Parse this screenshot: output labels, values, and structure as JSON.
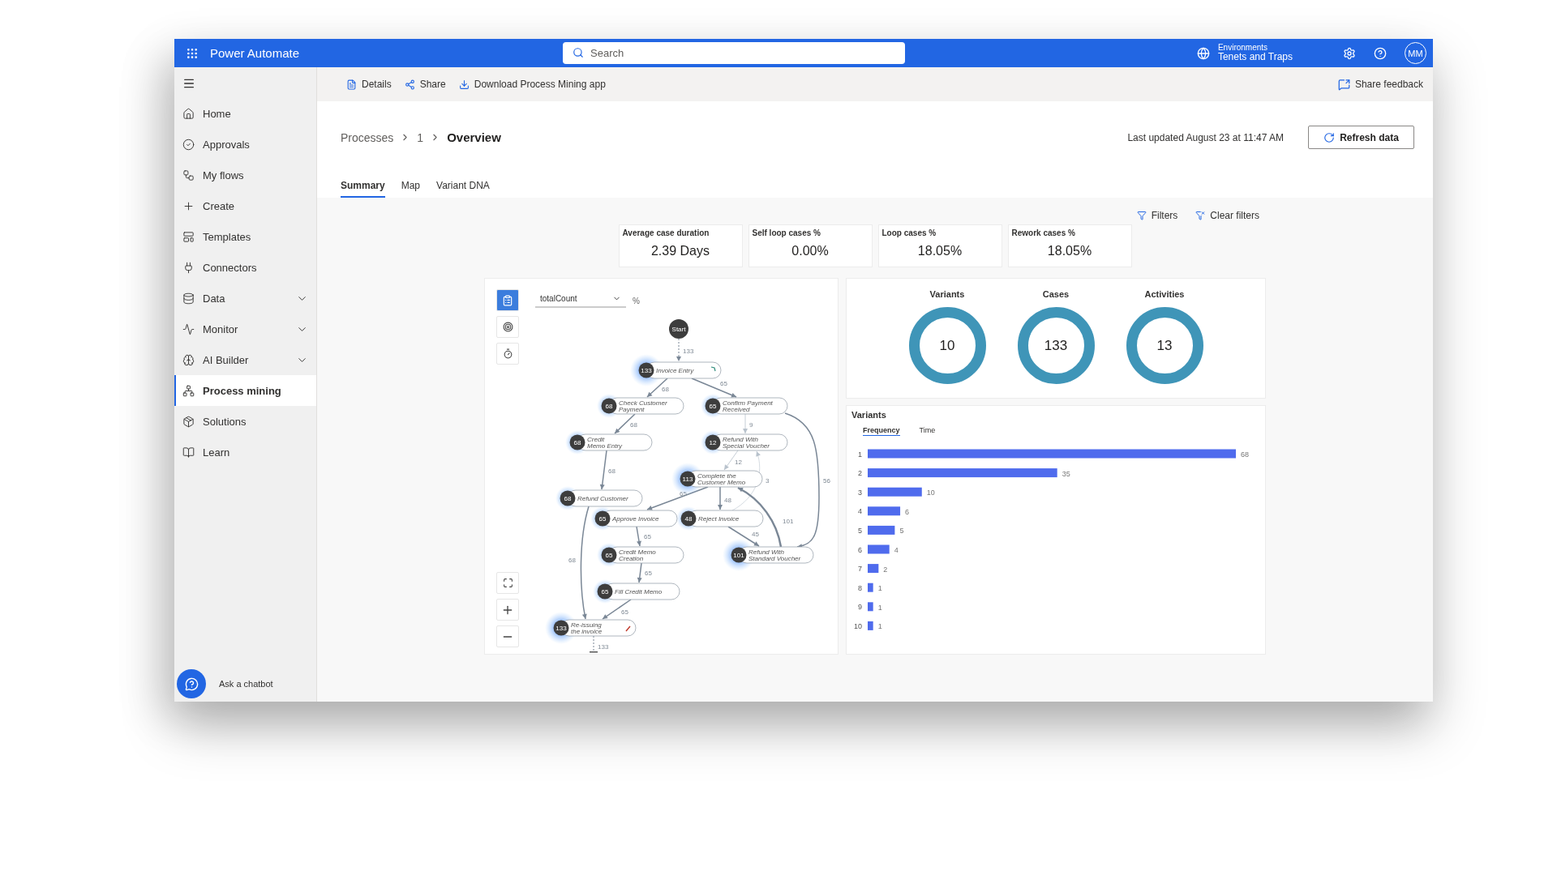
{
  "app": {
    "title": "Power Automate"
  },
  "search": {
    "placeholder": "Search"
  },
  "environment": {
    "caption": "Environments",
    "name": "Tenets and Traps"
  },
  "user": {
    "initials": "MM"
  },
  "command_bar": {
    "items": [
      "Details",
      "Share",
      "Download Process Mining app"
    ],
    "feedback": "Share feedback"
  },
  "sidebar": {
    "items": [
      {
        "label": "Home",
        "expandable": false,
        "selected": false
      },
      {
        "label": "Approvals",
        "expandable": false,
        "selected": false
      },
      {
        "label": "My flows",
        "expandable": false,
        "selected": false
      },
      {
        "label": "Create",
        "expandable": false,
        "selected": false
      },
      {
        "label": "Templates",
        "expandable": false,
        "selected": false
      },
      {
        "label": "Connectors",
        "expandable": false,
        "selected": false
      },
      {
        "label": "Data",
        "expandable": true,
        "selected": false
      },
      {
        "label": "Monitor",
        "expandable": true,
        "selected": false
      },
      {
        "label": "AI Builder",
        "expandable": true,
        "selected": false
      },
      {
        "label": "Process mining",
        "expandable": false,
        "selected": true
      },
      {
        "label": "Solutions",
        "expandable": false,
        "selected": false
      },
      {
        "label": "Learn",
        "expandable": false,
        "selected": false
      }
    ],
    "chatbot": "Ask a chatbot"
  },
  "breadcrumb": [
    "Processes",
    "1",
    "Overview"
  ],
  "last_updated": "Last updated August 23 at 11:47 AM",
  "refresh_button": "Refresh data",
  "tabs": [
    {
      "label": "Summary",
      "selected": true
    },
    {
      "label": "Map",
      "selected": false
    },
    {
      "label": "Variant DNA",
      "selected": false
    }
  ],
  "filters": [
    "Filters",
    "Clear filters"
  ],
  "kpis": [
    {
      "label": "Average case duration",
      "value": "2.39 Days"
    },
    {
      "label": "Self loop cases %",
      "value": "0.00%"
    },
    {
      "label": "Loop cases %",
      "value": "18.05%"
    },
    {
      "label": "Rework cases %",
      "value": "18.05%"
    }
  ],
  "map": {
    "metric": "totalCount",
    "unit": "%",
    "start": "Start",
    "nodes": [
      {
        "kind": "start",
        "count": "133",
        "label": "Invoice Entry"
      },
      {
        "kind": "activity",
        "count": "68",
        "label": "Check Customer Payment"
      },
      {
        "kind": "activity",
        "count": "65",
        "label": "Confirm Payment Received"
      },
      {
        "kind": "activity",
        "count": "68",
        "label": "Credit Memo Entry"
      },
      {
        "kind": "activity",
        "count": "12",
        "label": "Refund With Special Voucher"
      },
      {
        "kind": "activity",
        "count": "113",
        "label": "Complete the Customer Memo"
      },
      {
        "kind": "activity",
        "count": "68",
        "label": "Refund Customer"
      },
      {
        "kind": "activity",
        "count": "65",
        "label": "Approve Invoice"
      },
      {
        "kind": "activity",
        "count": "48",
        "label": "Reject Invoice"
      },
      {
        "kind": "activity",
        "count": "65",
        "label": "Credit Memo Creation"
      },
      {
        "kind": "activity",
        "count": "101",
        "label": "Refund With Standard Voucher"
      },
      {
        "kind": "activity",
        "count": "65",
        "label": "Fill Credit Memo"
      },
      {
        "kind": "end",
        "count": "133",
        "label": "Re-issuing the invoice"
      }
    ],
    "edges": [
      {
        "label": "133"
      },
      {
        "label": "68"
      },
      {
        "label": "65"
      },
      {
        "label": "68"
      },
      {
        "label": "9"
      },
      {
        "label": "56"
      },
      {
        "label": "68"
      },
      {
        "label": "12"
      },
      {
        "label": "3"
      },
      {
        "label": "65"
      },
      {
        "label": "48"
      },
      {
        "label": "101"
      },
      {
        "label": "45"
      },
      {
        "label": "65"
      },
      {
        "label": "65"
      },
      {
        "label": "68"
      },
      {
        "label": "65"
      },
      {
        "label": "133"
      }
    ]
  },
  "stats": [
    {
      "label": "Variants",
      "value": "10"
    },
    {
      "label": "Cases",
      "value": "133"
    },
    {
      "label": "Activities",
      "value": "13"
    }
  ],
  "variants": {
    "title": "Variants",
    "tabs": [
      {
        "label": "Frequency",
        "selected": true
      },
      {
        "label": "Time",
        "selected": false
      }
    ],
    "chart_data": {
      "type": "bar",
      "orientation": "horizontal",
      "categories": [
        "1",
        "2",
        "3",
        "4",
        "5",
        "6",
        "7",
        "8",
        "9",
        "10"
      ],
      "series": [
        {
          "color": "#4f6bed",
          "values": [
            68,
            35,
            10,
            6,
            5,
            4,
            2,
            1,
            1,
            1
          ]
        }
      ],
      "data_labels": true
    }
  }
}
